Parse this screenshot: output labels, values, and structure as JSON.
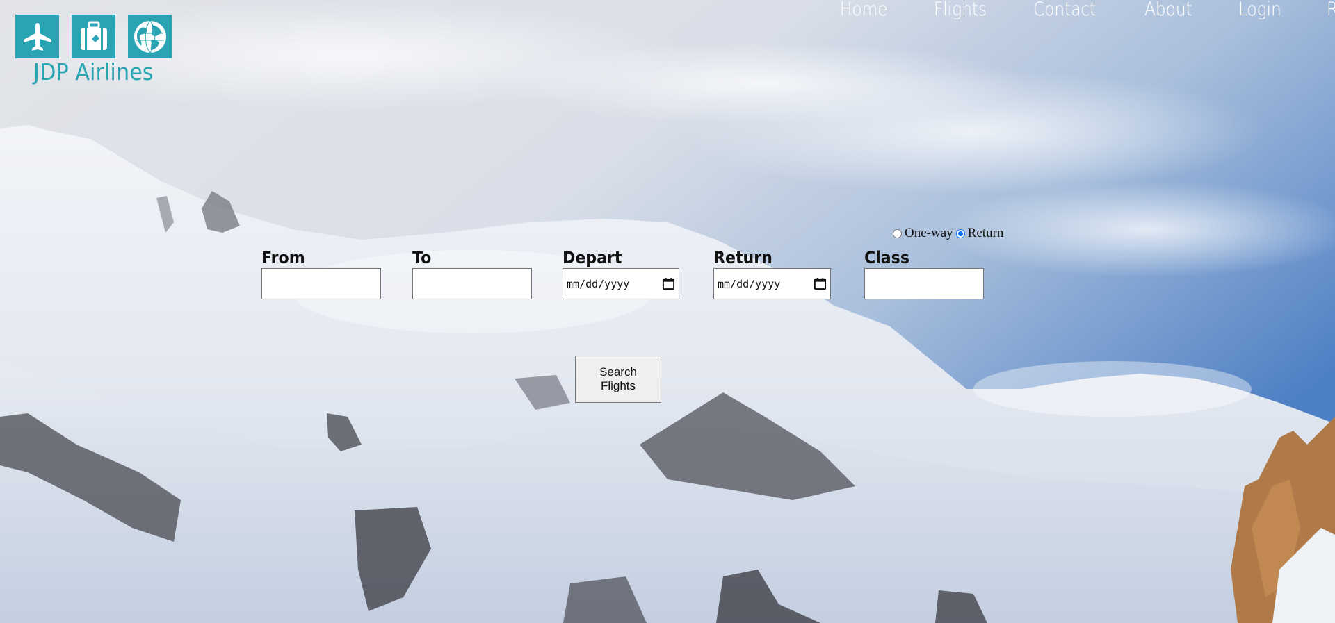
{
  "brand": {
    "name": "JDP Airlines"
  },
  "logo_icons": [
    "airplane-icon",
    "luggage-icon",
    "globe-icon"
  ],
  "nav": {
    "items": [
      "Home",
      "Flights",
      "Contact",
      "About",
      "Login",
      "Register"
    ]
  },
  "trip_type": {
    "options": [
      "One-way",
      "Return"
    ],
    "selected": "Return"
  },
  "form": {
    "from_label": "From",
    "to_label": "To",
    "depart_label": "Depart",
    "return_label": "Return",
    "class_label": "Class",
    "from_value": "",
    "to_value": "",
    "depart_value": "mm/dd/yyyy",
    "return_value": "mm/dd/yyyy",
    "class_value": ""
  },
  "search_button": "Search Flights",
  "colors": {
    "brand": "#2aa4b2",
    "nav_text": "#ffffff",
    "radio_selected": "#0075ff"
  }
}
